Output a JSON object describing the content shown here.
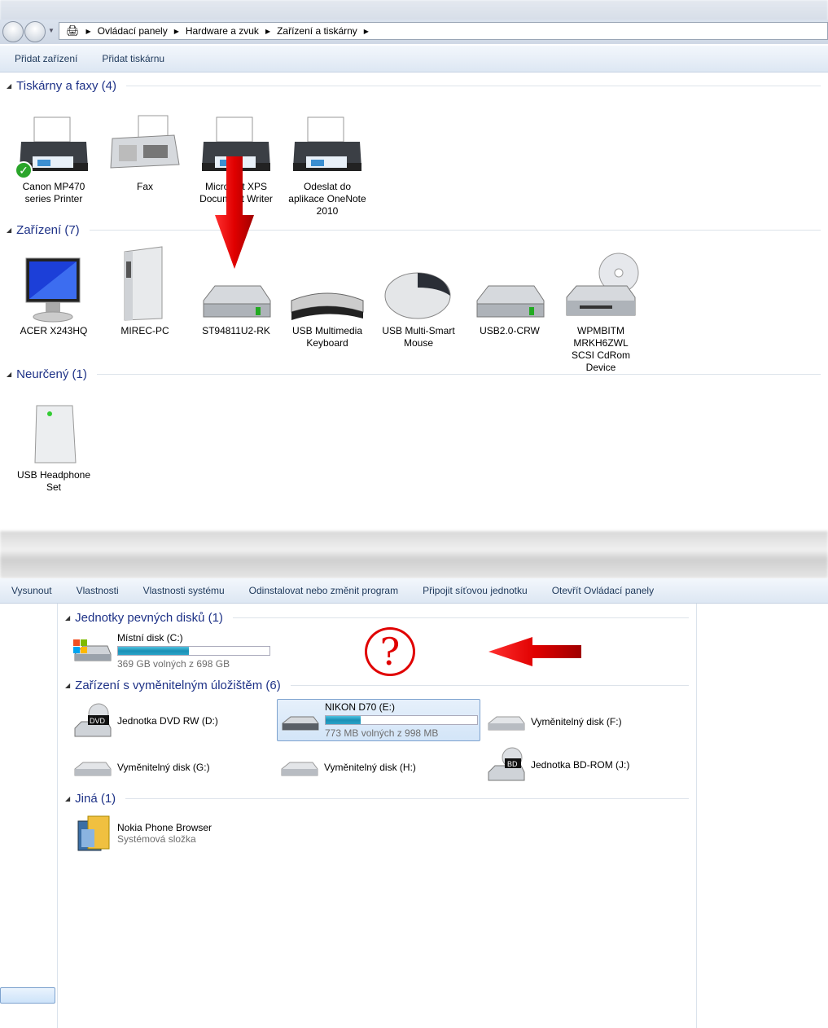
{
  "top_window": {
    "breadcrumb": [
      "Ovládací panely",
      "Hardware a zvuk",
      "Zařízení a tiskárny"
    ],
    "commands": [
      "Přidat zařízení",
      "Přidat tiskárnu"
    ],
    "groups": [
      {
        "title": "Tiskárny a faxy (4)",
        "items": [
          {
            "label": "Canon MP470 series Printer",
            "icon": "printer-icon",
            "default": true
          },
          {
            "label": "Fax",
            "icon": "fax-icon"
          },
          {
            "label": "Microsoft XPS Document Writer",
            "icon": "printer-icon"
          },
          {
            "label": "Odeslat do aplikace OneNote 2010",
            "icon": "printer-icon"
          }
        ]
      },
      {
        "title": "Zařízení (7)",
        "items": [
          {
            "label": "ACER X243HQ",
            "icon": "monitor-icon"
          },
          {
            "label": "MIREC-PC",
            "icon": "computer-tower-icon"
          },
          {
            "label": "ST94811U2-RK",
            "icon": "hard-drive-icon"
          },
          {
            "label": "USB Multimedia Keyboard",
            "icon": "keyboard-icon"
          },
          {
            "label": "USB Multi-Smart Mouse",
            "icon": "mouse-icon"
          },
          {
            "label": "USB2.0-CRW",
            "icon": "hard-drive-icon"
          },
          {
            "label": "WPMBITM MRKH6ZWL SCSI CdRom Device",
            "icon": "cdrom-icon"
          }
        ]
      },
      {
        "title": "Neurčený (1)",
        "items": [
          {
            "label": "USB Headphone Set",
            "icon": "generic-device-icon"
          }
        ]
      }
    ]
  },
  "bottom_window": {
    "commands": [
      "Vysunout",
      "Vlastnosti",
      "Vlastnosti systému",
      "Odinstalovat nebo změnit program",
      "Připojit síťovou jednotku",
      "Otevřít Ovládací panely"
    ],
    "groups": {
      "hdd": {
        "title": "Jednotky pevných disků (1)",
        "drives": [
          {
            "name": "Místní disk (C:)",
            "free": "369 GB volných z 698 GB",
            "used_percent": 47
          }
        ]
      },
      "removable": {
        "title": "Zařízení s vyměnitelným úložištěm (6)",
        "drives": [
          {
            "name": "Jednotka DVD RW (D:)",
            "badge": "DVD"
          },
          {
            "name": "NIKON D70 (E:)",
            "free": "773 MB volných z 998 MB",
            "used_percent": 23,
            "selected": true
          },
          {
            "name": "Vyměnitelný disk (F:)"
          },
          {
            "name": "Vyměnitelný disk (G:)"
          },
          {
            "name": "Vyměnitelný disk (H:)"
          },
          {
            "name": "Jednotka BD-ROM (J:)",
            "badge": "BD"
          }
        ]
      },
      "other": {
        "title": "Jiná (1)",
        "items": [
          {
            "name": "Nokia Phone Browser",
            "sub": "Systémová složka"
          }
        ]
      }
    },
    "annotation": "?"
  },
  "colors": {
    "group_title": "#1e3287",
    "annotation_red": "#e00000",
    "progress": "#1a8fb5"
  }
}
